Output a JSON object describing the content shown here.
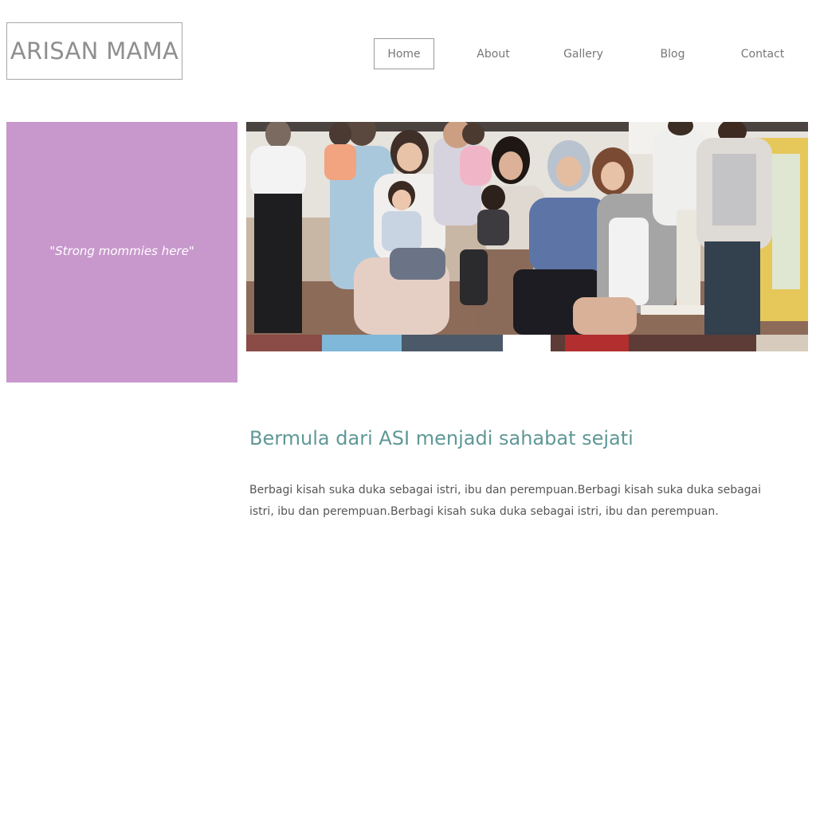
{
  "site": {
    "logo_text": "ARISAN MAMA"
  },
  "nav": {
    "items": [
      "Home",
      "About",
      "Gallery",
      "Blog",
      "Contact"
    ],
    "active": "Home"
  },
  "hero": {
    "quote": "\"Strong mommies here\"",
    "quote_box_color": "#c898cc",
    "photo_subject": "group-photo-mothers-and-children"
  },
  "main": {
    "headline": "Bermula dari ASI menjadi sahabat sejati",
    "paragraph": "Berbagi kisah suka duka sebagai istri, ibu dan perempuan.Berbagi kisah suka duka sebagai istri, ibu dan perempuan.Berbagi kisah suka duka sebagai istri, ibu dan perempuan."
  },
  "colors": {
    "heading": "#5f9896",
    "text": "#555555",
    "nav_text": "#777777",
    "logo_text": "#8f8f8f"
  }
}
